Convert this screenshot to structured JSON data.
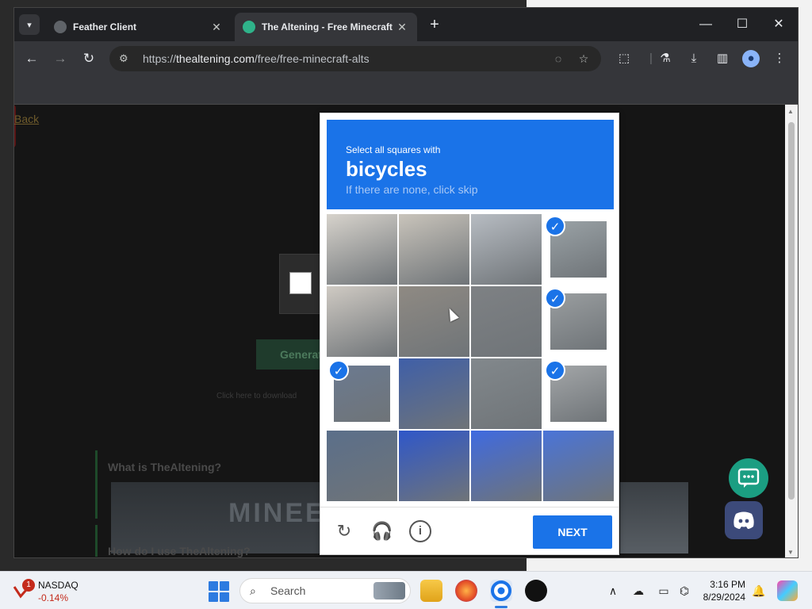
{
  "browser": {
    "tabs": [
      {
        "title": "Feather Client",
        "active": false
      },
      {
        "title": "The Altening - Free Minecraft A",
        "active": true
      }
    ],
    "url_scheme": "https://",
    "url_domain": "thealtening.com",
    "url_path": "/free/free-minecraft-alts"
  },
  "page": {
    "back_link": "Back",
    "generate_button": "Generate",
    "download_hint": "Click here to download",
    "faq_q1": "What is TheAltening?",
    "faq_q2": "How do I use TheAltening?",
    "banner_text": "MINEE"
  },
  "captcha": {
    "prompt_pre": "Select all squares with",
    "prompt_object": "bicycles",
    "prompt_sub": "If there are none, click skip",
    "next_label": "NEXT",
    "selected_tiles": [
      4,
      8,
      9,
      12
    ],
    "accent": "#1a73e8"
  },
  "taskbar": {
    "stock_name": "NASDAQ",
    "stock_change": "-0.14%",
    "stock_badge": "1",
    "search_label": "Search",
    "time": "3:16 PM",
    "date": "8/29/2024"
  }
}
